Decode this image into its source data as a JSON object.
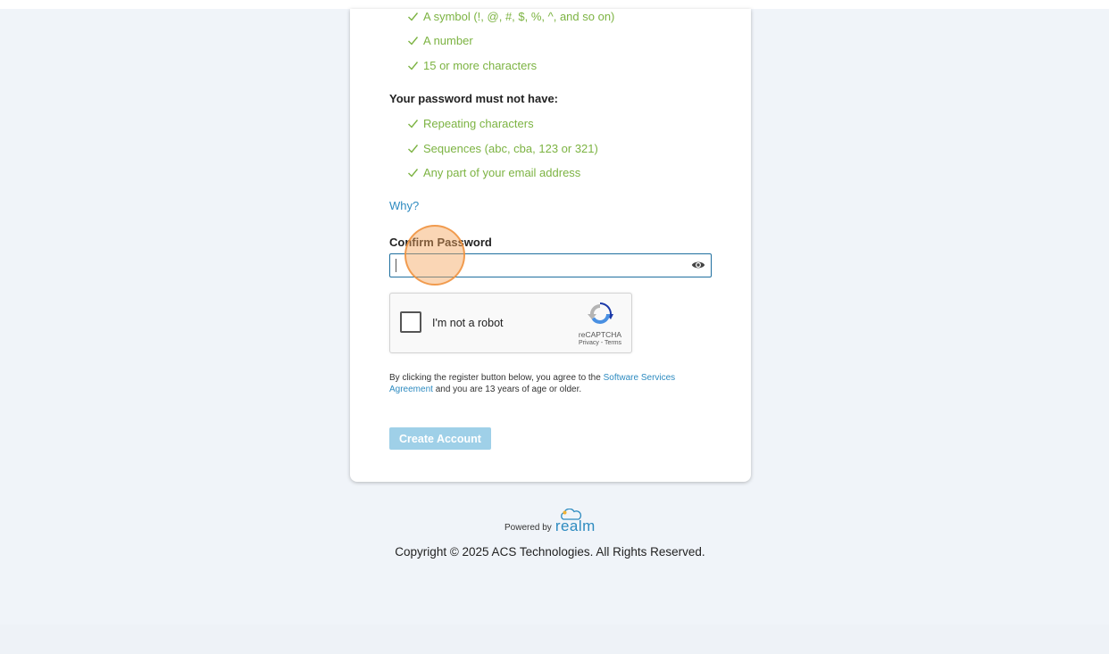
{
  "requirements_have": [
    "A symbol (!, @, #, $, %, ^, and so on)",
    "A number",
    "15 or more characters"
  ],
  "must_not_have_label": "Your password must not have:",
  "requirements_not": [
    "Repeating characters",
    "Sequences (abc, cba, 123 or 321)",
    "Any part of your email address"
  ],
  "why_link": "Why?",
  "confirm_password": {
    "label": "Confirm Password",
    "value": ""
  },
  "recaptcha": {
    "label": "I'm not a robot",
    "brand": "reCAPTCHA",
    "privacy": "Privacy",
    "separator": " - ",
    "terms": "Terms"
  },
  "agreement": {
    "prefix": "By clicking the register button below, you agree to the ",
    "link": "Software Services Agreement",
    "suffix": " and you are 13 years of age or older."
  },
  "create_account_button": "Create Account",
  "footer": {
    "powered_by": "Powered by",
    "brand": "realm",
    "copyright": "Copyright © 2025 ACS Technologies. All Rights Reserved."
  },
  "colors": {
    "requirement_met": "#7cb342",
    "link": "#2e8bc0",
    "button_disabled": "#9fd0e8",
    "input_focus_border": "#1f6f9f",
    "page_background": "#f0f4f9"
  }
}
